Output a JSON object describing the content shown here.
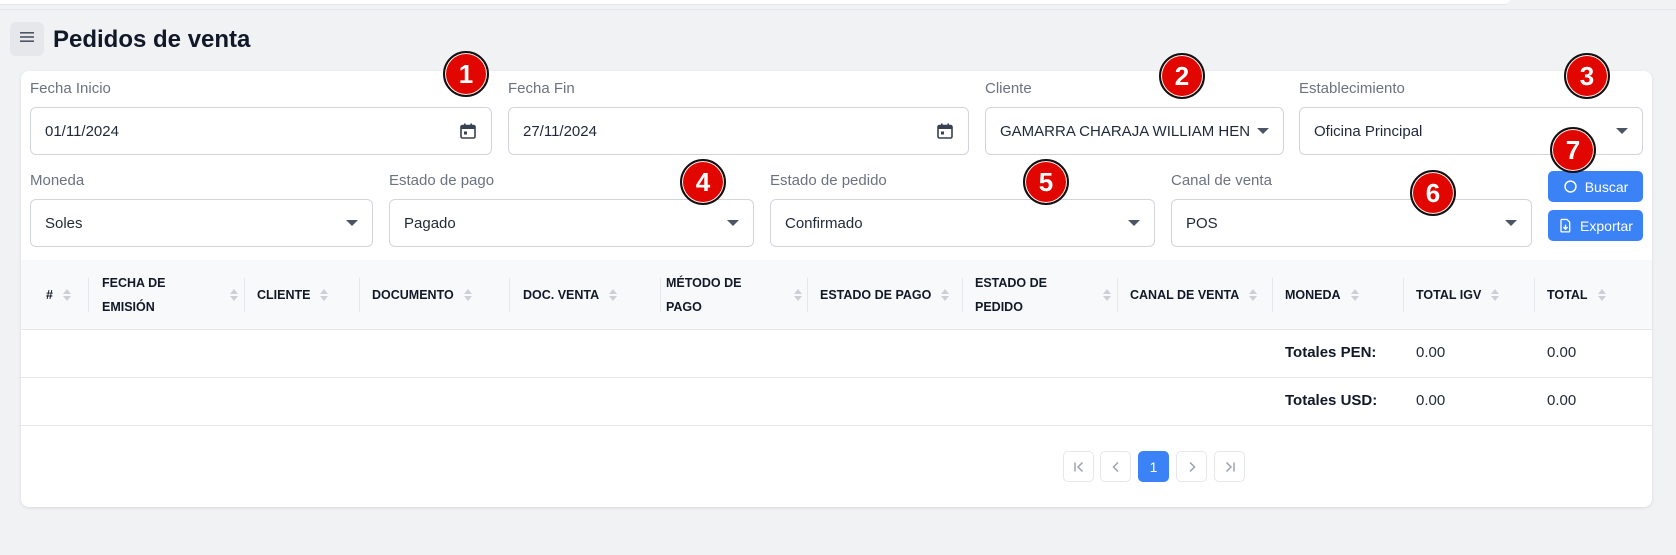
{
  "page": {
    "title": "Pedidos de venta"
  },
  "icons": {
    "menu": "menu-icon",
    "calendar": "calendar-icon",
    "search": "search-icon",
    "export": "export-icon"
  },
  "colors": {
    "primary": "#3b82f6",
    "badge": "#e10600",
    "background": "#f1f2f4"
  },
  "filters": {
    "fecha_inicio": {
      "label": "Fecha Inicio",
      "value": "01/11/2024"
    },
    "fecha_fin": {
      "label": "Fecha Fin",
      "value": "27/11/2024"
    },
    "cliente": {
      "label": "Cliente",
      "value": "GAMARRA CHARAJA WILLIAM HENRY"
    },
    "establecimiento": {
      "label": "Establecimiento",
      "value": "Oficina Principal"
    },
    "moneda": {
      "label": "Moneda",
      "value": "Soles"
    },
    "estado_pago": {
      "label": "Estado de pago",
      "value": "Pagado"
    },
    "estado_pedido": {
      "label": "Estado de pedido",
      "value": "Confirmado"
    },
    "canal_venta": {
      "label": "Canal de venta",
      "value": "POS"
    }
  },
  "buttons": {
    "buscar": "Buscar",
    "exportar": "Exportar"
  },
  "badges": [
    "1",
    "2",
    "3",
    "4",
    "5",
    "6",
    "7"
  ],
  "table": {
    "columns": [
      [
        "#"
      ],
      [
        "FECHA DE",
        "EMISIÓN"
      ],
      [
        "CLIENTE"
      ],
      [
        "DOCUMENTO"
      ],
      [
        "DOC. VENTA"
      ],
      [
        "MÉTODO DE",
        "PAGO"
      ],
      [
        "ESTADO DE PAGO"
      ],
      [
        "ESTADO DE",
        "PEDIDO"
      ],
      [
        "CANAL DE VENTA"
      ],
      [
        "MONEDA"
      ],
      [
        "TOTAL IGV"
      ],
      [
        "TOTAL"
      ]
    ],
    "totals": [
      {
        "label": "Totales PEN:",
        "igv": "0.00",
        "total": "0.00"
      },
      {
        "label": "Totales USD:",
        "igv": "0.00",
        "total": "0.00"
      }
    ]
  },
  "pagination": {
    "current_page": "1"
  }
}
